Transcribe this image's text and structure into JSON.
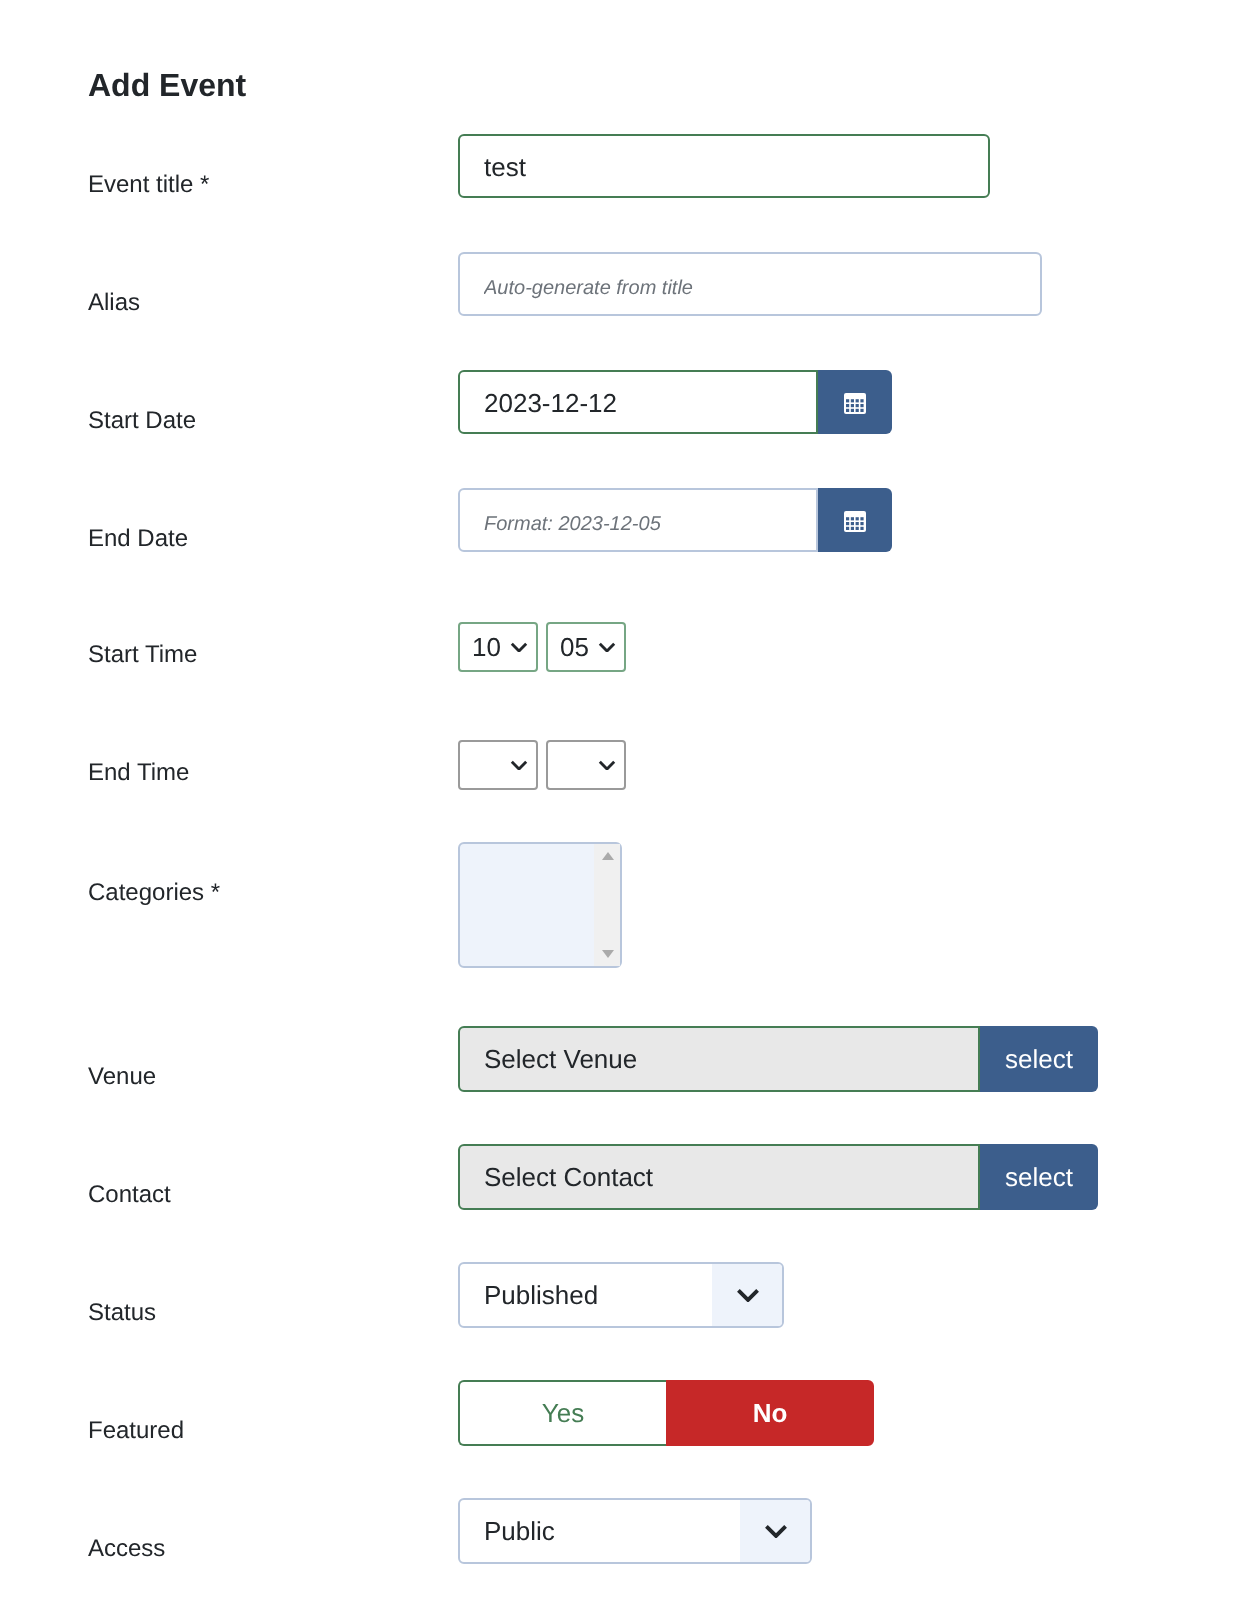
{
  "heading": "Add Event",
  "fields": [
    {
      "kind": "text",
      "label": "Event title *",
      "value": "test",
      "valid": true
    },
    {
      "kind": "text",
      "label": "Alias",
      "placeholder": "Auto-generate from title",
      "valid": false
    },
    {
      "kind": "date",
      "label": "Start Date",
      "value": "2023-12-12",
      "valid": true
    },
    {
      "kind": "date",
      "label": "End Date",
      "placeholder": "Format: 2023-12-05",
      "valid": false
    },
    {
      "kind": "time",
      "label": "Start Time",
      "hour": "10",
      "minute": "05",
      "valid": true
    },
    {
      "kind": "time",
      "label": "End Time",
      "valid": false
    },
    {
      "kind": "listbox",
      "label": "Categories *",
      "valid": false
    },
    {
      "kind": "picker",
      "label": "Venue",
      "value": "Select Venue",
      "button": "select",
      "valid": true
    },
    {
      "kind": "picker",
      "label": "Contact",
      "value": "Select Contact",
      "button": "select",
      "valid": true
    },
    {
      "kind": "select",
      "label": "Status",
      "value": "Published",
      "wide": false,
      "valid": false
    },
    {
      "kind": "toggle",
      "label": "Featured",
      "valid": true,
      "options": [
        {
          "label": "Yes",
          "selected": false
        },
        {
          "label": "No",
          "selected": true
        }
      ]
    },
    {
      "kind": "select",
      "label": "Access",
      "value": "Public",
      "wide": true,
      "valid": false
    }
  ]
}
